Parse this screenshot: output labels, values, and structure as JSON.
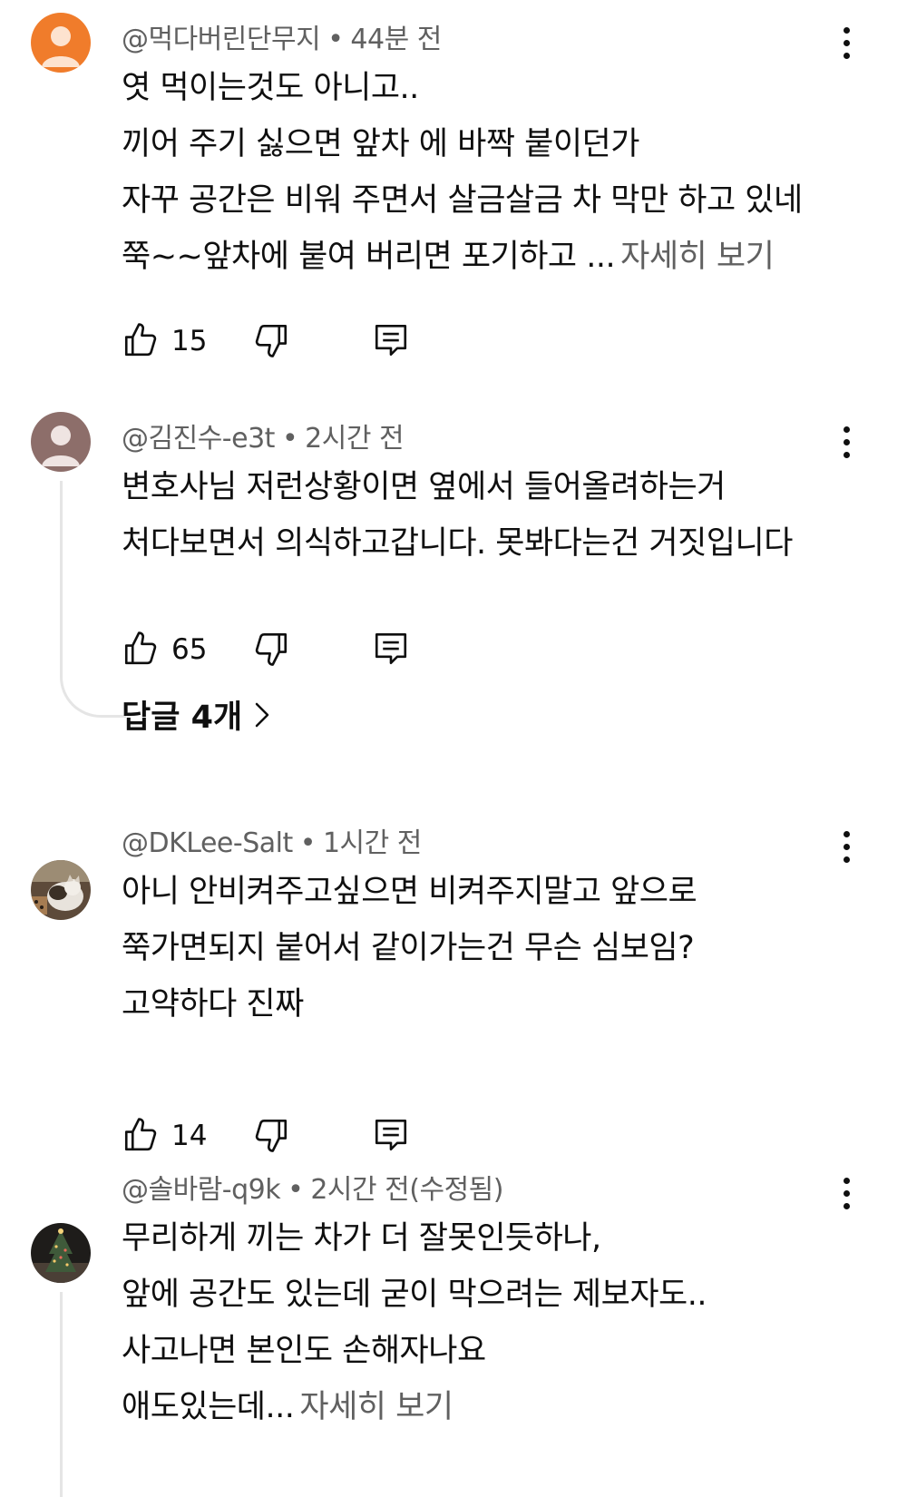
{
  "comments": [
    {
      "author": "@먹다버린단무지",
      "time": "44분 전",
      "lines": [
        "엿 먹이는것도 아니고..",
        "끼어 주기 싫으면 앞차 에 바짝 붙이던가",
        "자꾸 공간은 비워 주면서 살금살금 차 막만 하고 있네",
        "쭉~~앞차에 붙여 버리면 포기하고 ..."
      ],
      "more": "자세히 보기",
      "likes": "15",
      "avatar_color": "#f07c2b"
    },
    {
      "author": "@김진수-e3t",
      "time": "2시간 전",
      "lines": [
        "변호사님 저런상황이면 옆에서 들어올려하는거",
        "처다보면서 의식하고갑니다. 못봐다는건 거짓입니다"
      ],
      "likes": "65",
      "replies": "답글 4개",
      "avatar_color": "#8d6e6a"
    },
    {
      "author": "@DKLee-Salt",
      "time": "1시간 전",
      "lines": [
        "아니 안비켜주고싶으면 비켜주지말고 앞으로",
        "쭉가면되지 붙어서 같이가는건 무슨 심보임?",
        "고약하다 진짜"
      ],
      "likes": "14"
    },
    {
      "author": "@솔바람-q9k",
      "time": "2시간 전(수정됨)",
      "lines": [
        "무리하게 끼는 차가 더 잘못인듯하나,",
        "앞에 공간도 있는데 굳이 막으려는 제보자도..",
        "사고나면 본인도 손해자나요",
        "애도있는데..."
      ],
      "more": "자세히 보기"
    }
  ],
  "icons": {
    "like": "thumbs-up-icon",
    "dislike": "thumbs-down-icon",
    "reply": "reply-comment-icon",
    "more": "more-vertical-icon",
    "chevron": "chevron-right-icon"
  }
}
